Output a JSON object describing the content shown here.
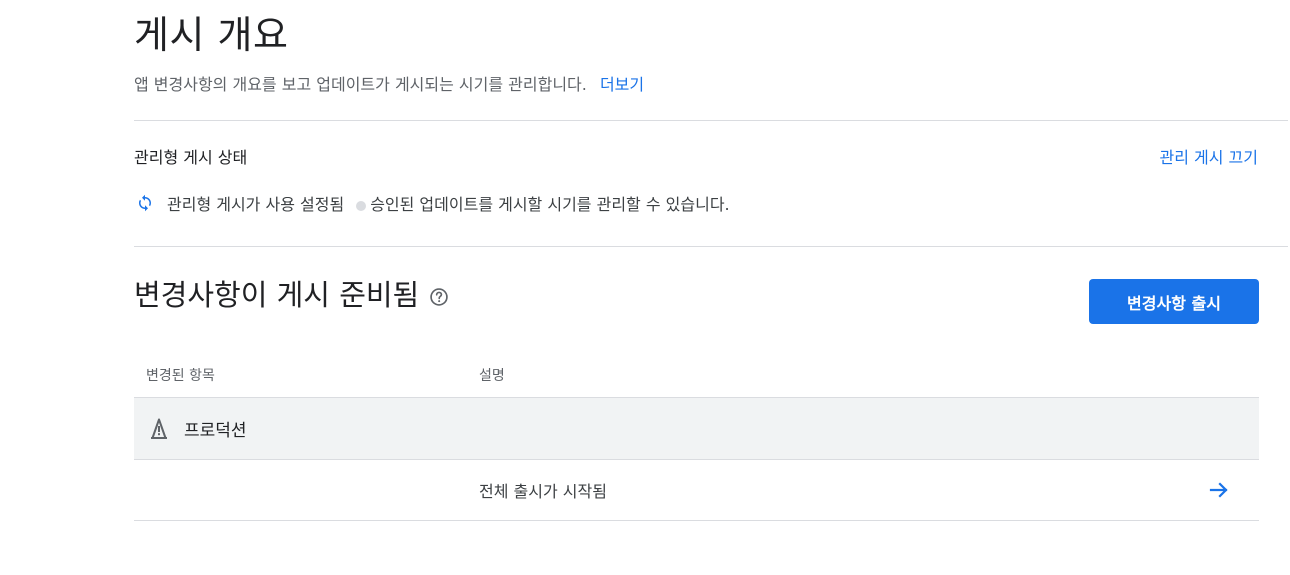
{
  "header": {
    "title": "게시 개요",
    "subtitle": "앱 변경사항의 개요를 보고 업데이트가 게시되는 시기를 관리합니다.",
    "learn_more": "더보기"
  },
  "managed_publishing": {
    "heading": "관리형 게시 상태",
    "turn_off_label": "관리 게시 끄기",
    "status_text": "관리형 게시가 사용 설정됨",
    "status_description": "승인된 업데이트를 게시할 시기를 관리할 수 있습니다.",
    "status_icon": "sync-icon"
  },
  "ready_section": {
    "title": "변경사항이 게시 준비됨",
    "help_icon": "help-icon",
    "publish_button_label": "변경사항 출시",
    "table": {
      "columns": [
        "변경된 항목",
        "설명"
      ],
      "group": {
        "label": "프로덕션",
        "icon": "production-track-icon"
      },
      "rows": [
        {
          "item": "",
          "description": "전체 출시가 시작됨",
          "action_icon": "arrow-forward-icon"
        }
      ]
    }
  },
  "colors": {
    "accent": "#1a73e8",
    "divider": "#dadce0",
    "group_background": "#f1f3f4"
  }
}
